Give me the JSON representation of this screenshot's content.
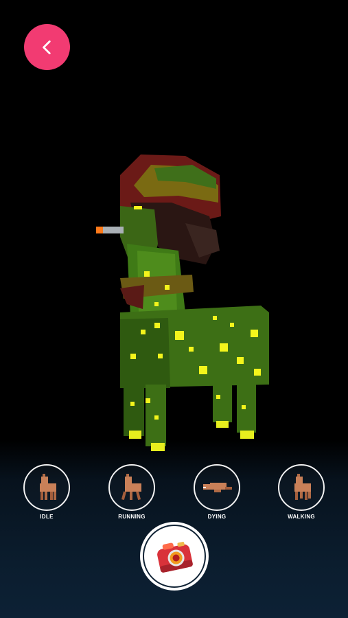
{
  "header": {
    "back_icon": "chevron-left-icon",
    "accent": "#f23b72"
  },
  "animations": [
    {
      "label": "IDLE",
      "icon": "llama-idle-icon"
    },
    {
      "label": "RUNNING",
      "icon": "llama-running-icon"
    },
    {
      "label": "DYING",
      "icon": "llama-dying-icon"
    },
    {
      "label": "WALKING",
      "icon": "llama-walking-icon"
    }
  ],
  "capture": {
    "icon": "camera-icon"
  }
}
